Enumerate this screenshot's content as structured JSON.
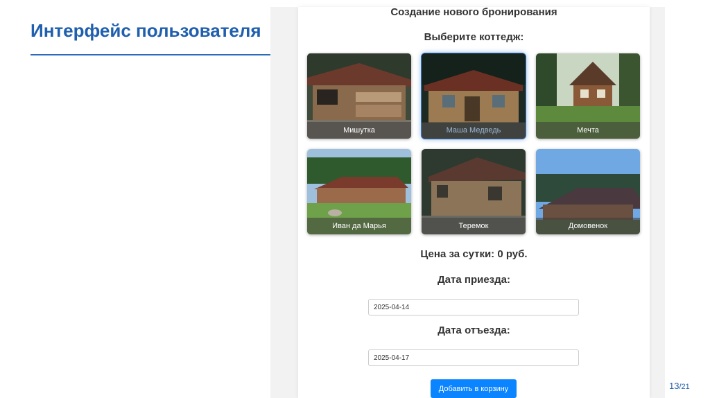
{
  "slide": {
    "title": "Интерфейс пользователя",
    "page_current": "13",
    "page_total": "/21",
    "accent_color": "#1f5fae"
  },
  "form": {
    "heading": "Создание нового бронирования",
    "choose_label": "Выберите коттедж:",
    "price_label": "Цена за сутки: 0 руб.",
    "arrival_label": "Дата приезда:",
    "arrival_value": "2025-04-14",
    "departure_label": "Дата отъезда:",
    "departure_value": "2025-04-17",
    "submit_label": "Добавить в корзину",
    "submit_color": "#0a84ff"
  },
  "cottages": [
    {
      "name": "Мишутка",
      "selected": false
    },
    {
      "name": "Маша Медведь",
      "selected": true
    },
    {
      "name": "Мечта",
      "selected": false
    },
    {
      "name": "Иван да Марья",
      "selected": false
    },
    {
      "name": "Теремок",
      "selected": false
    },
    {
      "name": "Домовенок",
      "selected": false
    }
  ]
}
